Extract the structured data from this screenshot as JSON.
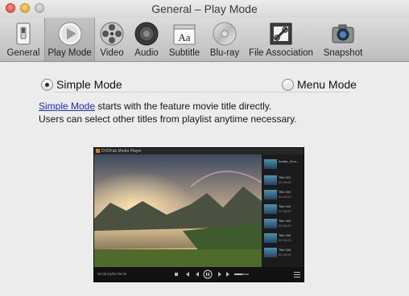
{
  "window": {
    "title": "General – Play Mode"
  },
  "toolbar": {
    "items": [
      {
        "label": "General",
        "icon": "general-switch-icon"
      },
      {
        "label": "Play Mode",
        "icon": "play-icon"
      },
      {
        "label": "Video",
        "icon": "film-reel-icon"
      },
      {
        "label": "Audio",
        "icon": "speaker-icon"
      },
      {
        "label": "Subtitle",
        "icon": "subtitle-icon"
      },
      {
        "label": "Blu-ray",
        "icon": "disc-icon"
      },
      {
        "label": "File Association",
        "icon": "file-link-icon"
      },
      {
        "label": "Snapshot",
        "icon": "camera-icon"
      }
    ]
  },
  "modes": {
    "simple_label": "Simple Mode",
    "menu_label": "Menu Mode",
    "selected": "Simple Mode"
  },
  "description": {
    "link": "Simple Mode",
    "line1_rest": " starts with the feature movie title directly.",
    "line2": "Users can select other titles from playlist anytime necessary."
  },
  "preview": {
    "app_title": "DVDFab Media Player",
    "playlist": [
      {
        "title": "Avatar_Smo...",
        "time": ""
      },
      {
        "title": "Title 001",
        "time": "02:38:05"
      },
      {
        "title": "Title 002",
        "time": "00:36:03"
      },
      {
        "title": "Title 003",
        "time": "02:38:05"
      },
      {
        "title": "Title 004",
        "time": "02:38:05"
      },
      {
        "title": "Title 005",
        "time": "00:36:03"
      },
      {
        "title": "Title 006",
        "time": "02:38:05"
      }
    ],
    "time": "00:35:24/02:35:45",
    "accent": "#e07a1f"
  }
}
